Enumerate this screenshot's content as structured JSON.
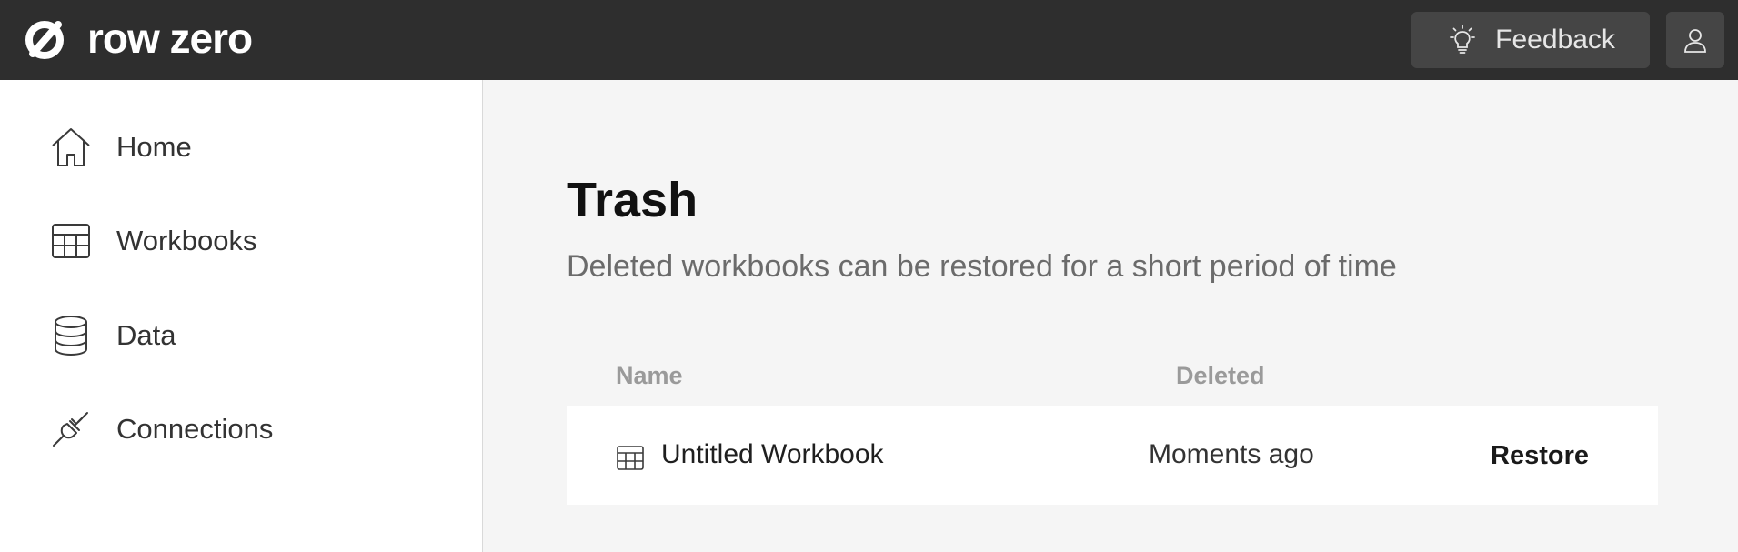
{
  "app": {
    "logo_text": "row zero",
    "logo_icon": "row-zero-logo"
  },
  "header": {
    "feedback_label": "Feedback",
    "feedback_icon": "lightbulb-icon",
    "user_icon": "user-icon"
  },
  "sidebar": {
    "items": [
      {
        "label": "Home",
        "icon": "home-icon"
      },
      {
        "label": "Workbooks",
        "icon": "table-icon"
      },
      {
        "label": "Data",
        "icon": "database-icon"
      },
      {
        "label": "Connections",
        "icon": "plug-icon"
      }
    ]
  },
  "main": {
    "title": "Trash",
    "subtitle": "Deleted workbooks can be restored for a short period of time",
    "table": {
      "columns": [
        "Name",
        "Deleted"
      ],
      "rows": [
        {
          "name": "Untitled Workbook",
          "icon": "table-icon",
          "deleted": "Moments ago",
          "action": "Restore"
        }
      ]
    }
  },
  "colors": {
    "topbar": "#2e2e2e",
    "button_bg": "#454545",
    "page_bg": "#f5f5f5",
    "sidebar_bg": "#ffffff"
  }
}
